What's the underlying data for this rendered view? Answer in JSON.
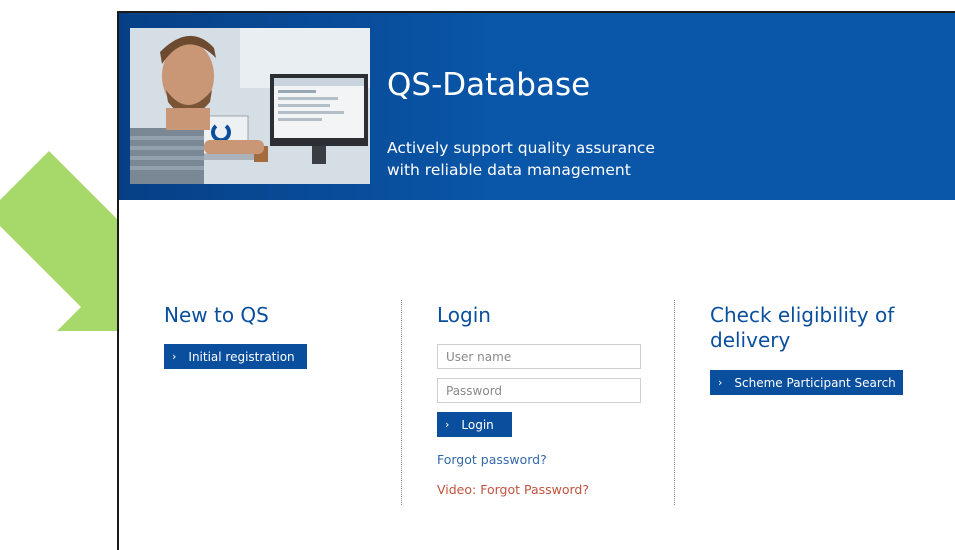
{
  "banner": {
    "title": "QS-Database",
    "subtitle_line1": "Actively support quality assurance",
    "subtitle_line2": "with reliable data management"
  },
  "new_to_qs": {
    "heading": "New to QS",
    "button_label": "Initial registration"
  },
  "login": {
    "heading": "Login",
    "username_placeholder": "User name",
    "password_placeholder": "Password",
    "button_label": "Login",
    "forgot_password": "Forgot password?",
    "video_forgot_password": "Video: Forgot Password?"
  },
  "eligibility": {
    "heading_line1": "Check eligibility of",
    "heading_line2": "delivery",
    "button_label": "Scheme Participant Search"
  },
  "icons": {
    "chevron": "›"
  },
  "colors": {
    "brand_blue": "#0a4f9e",
    "banner_blue": "#0a56a8",
    "video_link": "#c0533d",
    "arrow_green": "#a6d96a"
  }
}
